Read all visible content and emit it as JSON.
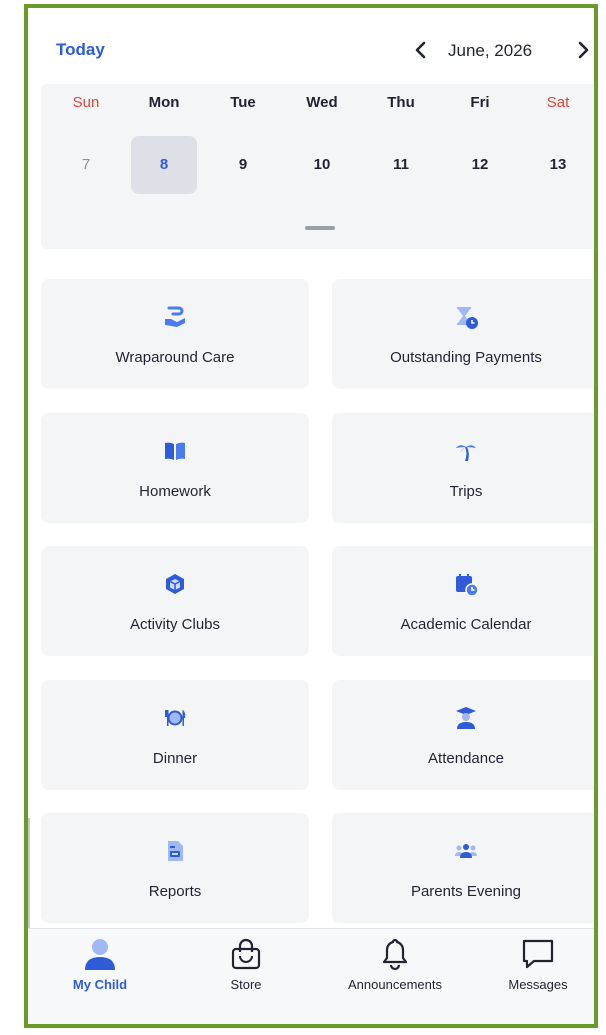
{
  "header": {
    "today_label": "Today",
    "month_label": "June, 2026",
    "prev_icon": "chevron-left-icon",
    "next_icon": "chevron-right-icon"
  },
  "calendar": {
    "weekdays": [
      "Sun",
      "Mon",
      "Tue",
      "Wed",
      "Thu",
      "Fri",
      "Sat"
    ],
    "dates": [
      "7",
      "8",
      "9",
      "10",
      "11",
      "12",
      "13"
    ],
    "selected_date": "8",
    "weekend_color": "#e0443a",
    "accent_color": "#2f5bd8"
  },
  "tiles": [
    {
      "label": "Wraparound Care",
      "icon": "hand-care-icon"
    },
    {
      "label": "Outstanding Payments",
      "icon": "hourglass-clock-icon"
    },
    {
      "label": "Homework",
      "icon": "book-icon"
    },
    {
      "label": "Trips",
      "icon": "palm-tree-icon"
    },
    {
      "label": "Activity Clubs",
      "icon": "box-icon"
    },
    {
      "label": "Academic Calendar",
      "icon": "calendar-clock-icon"
    },
    {
      "label": "Dinner",
      "icon": "plate-cutlery-icon"
    },
    {
      "label": "Attendance",
      "icon": "graduate-icon"
    },
    {
      "label": "Reports",
      "icon": "document-icon"
    },
    {
      "label": "Parents Evening",
      "icon": "people-group-icon"
    }
  ],
  "tabbar": {
    "items": [
      {
        "label": "My Child",
        "icon": "person-icon",
        "active": true
      },
      {
        "label": "Store",
        "icon": "shopping-bag-icon"
      },
      {
        "label": "Announcements",
        "icon": "bell-icon"
      },
      {
        "label": "Messages",
        "icon": "chat-bubble-icon"
      }
    ]
  }
}
